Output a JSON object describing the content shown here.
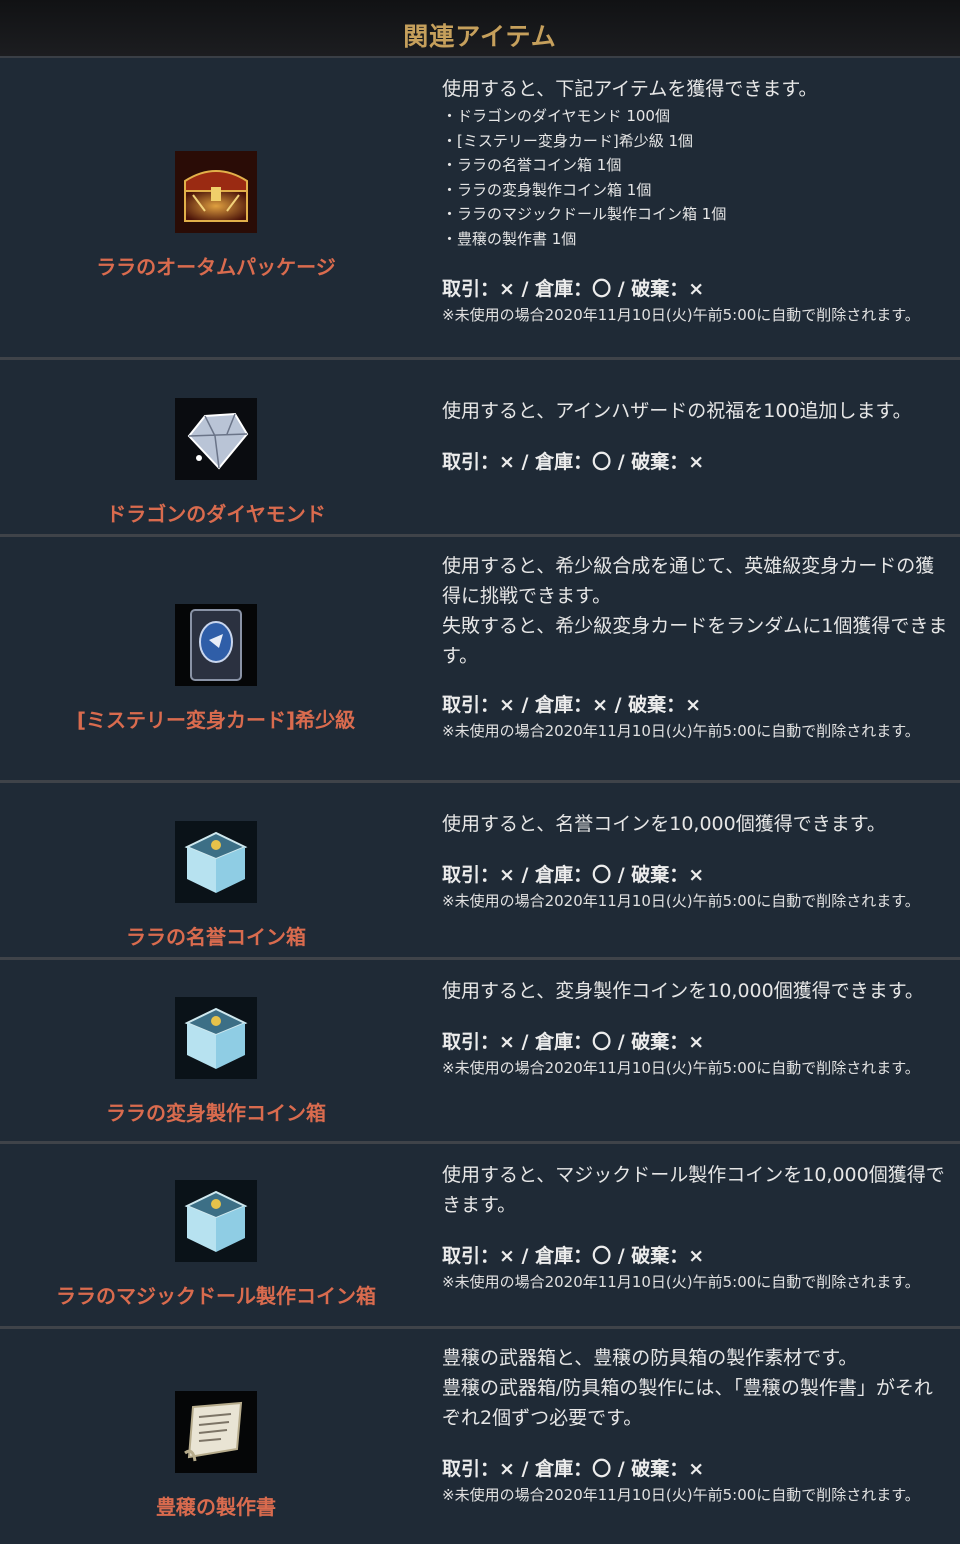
{
  "header": {
    "title": "関連アイテム"
  },
  "items": [
    {
      "name": "ララのオータムパッケージ",
      "icon": "treasure-chest-icon",
      "desc": [
        "使用すると、下記アイテムを獲得できます。"
      ],
      "sublist": [
        "・ドラゴンのダイヤモンド 100個",
        "・[ミステリー変身カード]希少級 1個",
        "・ララの名誉コイン箱 1個",
        "・ララの変身製作コイン箱 1個",
        "・ララのマジックドール製作コイン箱 1個",
        "・豊穣の製作書 1個"
      ],
      "trade": "取引：× / 倉庫：〇 / 破棄：×",
      "note": "※未使用の場合2020年11月10日(火)午前5:00に自動で削除されます。"
    },
    {
      "name": "ドラゴンのダイヤモンド",
      "icon": "diamond-icon",
      "desc": [
        "使用すると、アインハザードの祝福を100追加します。"
      ],
      "trade": "取引：× / 倉庫：〇 / 破棄：×",
      "note": ""
    },
    {
      "name": "[ミステリー変身カード]希少級",
      "icon": "mystery-card-icon",
      "desc": [
        "使用すると、希少級合成を通じて、英雄級変身カードの獲得に挑戦できます。",
        "失敗すると、希少級変身カードをランダムに1個獲得できます。"
      ],
      "trade": "取引：× / 倉庫：× / 破棄：×",
      "note": "※未使用の場合2020年11月10日(火)午前5:00に自動で削除されます。"
    },
    {
      "name": "ララの名誉コイン箱",
      "icon": "coin-box-icon",
      "desc": [
        "使用すると、名誉コインを10,000個獲得できます。"
      ],
      "trade": "取引：× / 倉庫：〇 / 破棄：×",
      "note": "※未使用の場合2020年11月10日(火)午前5:00に自動で削除されます。"
    },
    {
      "name": "ララの変身製作コイン箱",
      "icon": "coin-box-icon",
      "desc": [
        "使用すると、変身製作コインを10,000個獲得できます。"
      ],
      "trade": "取引：× / 倉庫：〇 / 破棄：×",
      "note": "※未使用の場合2020年11月10日(火)午前5:00に自動で削除されます。"
    },
    {
      "name": "ララのマジックドール製作コイン箱",
      "icon": "coin-box-icon",
      "desc": [
        "使用すると、マジックドール製作コインを10,000個獲得できます。"
      ],
      "trade": "取引：× / 倉庫：〇 / 破棄：×",
      "note": "※未使用の場合2020年11月10日(火)午前5:00に自動で削除されます。"
    },
    {
      "name": "豊穣の製作書",
      "icon": "scroll-icon",
      "desc": [
        "豊穣の武器箱と、豊穣の防具箱の製作素材です。",
        "豊穣の武器箱/防具箱の製作には、「豊穣の製作書」がそれぞれ2個ずつ必要です。"
      ],
      "trade": "取引：× / 倉庫：〇 / 破棄：×",
      "note": "※未使用の場合2020年11月10日(火)午前5:00に自動で削除されます。"
    }
  ]
}
